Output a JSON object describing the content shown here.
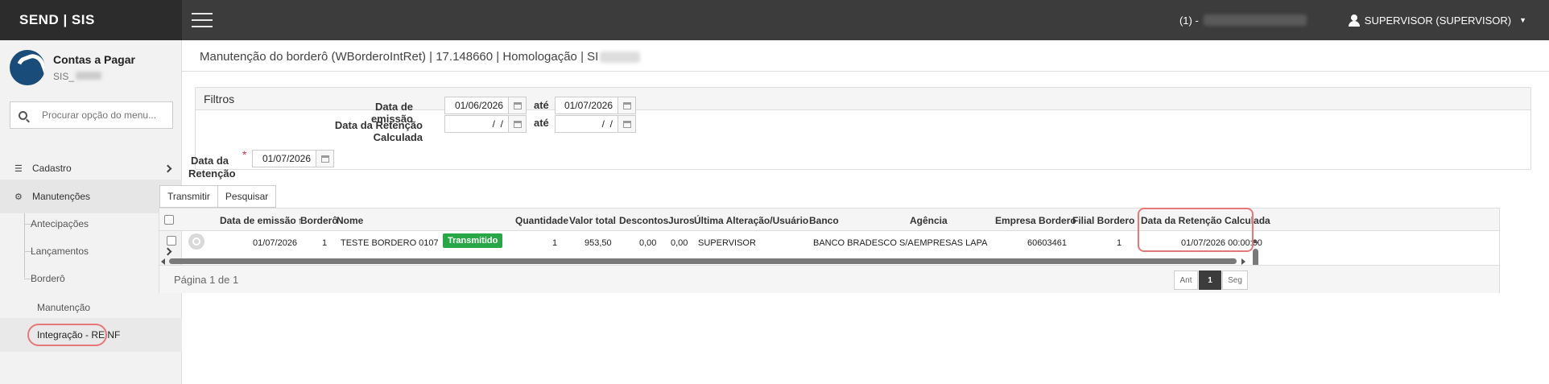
{
  "header": {
    "brand": "SEND | SIS",
    "session_prefix": "(1) -",
    "user": "SUPERVISOR (SUPERVISOR)"
  },
  "sidebar": {
    "title": "Contas a Pagar",
    "subtitle": "SIS_",
    "search_placeholder": "Procurar opção do menu...",
    "items": [
      {
        "label": "Cadastro",
        "icon": "list-icon"
      },
      {
        "label": "Manutenções",
        "icon": "gears-icon"
      }
    ],
    "subitems": [
      {
        "label": "Antecipações"
      },
      {
        "label": "Lançamentos"
      },
      {
        "label": "Borderô"
      }
    ],
    "leaves": [
      {
        "label": "Manutenção"
      },
      {
        "label": "Integração - REINF"
      }
    ]
  },
  "page": {
    "title": "Manutenção do borderô (WBorderoIntRet) | 17.148660 | Homologação | SI"
  },
  "filters": {
    "header": "Filtros",
    "emissao_label": "Data de emissão",
    "emissao_from": "01/06/2026",
    "emissao_to": "01/07/2026",
    "retencao_calc_label": "Data da Retenção Calculada",
    "retencao_calc_from": "  /  /",
    "retencao_calc_to": "  /  /",
    "ate_label": "até"
  },
  "retencao": {
    "label_line1": "Data da",
    "label_line2": "Retenção",
    "required_mark": "*",
    "value": "01/07/2026"
  },
  "toolbar": {
    "transmit_label": "Transmitir",
    "search_label": "Pesquisar"
  },
  "grid": {
    "columns": [
      "Data de emissão",
      "Borderô",
      "Nome",
      "Quantidade",
      "Valor total",
      "Descontos",
      "Juros",
      "Última Alteração/Usuário",
      "Banco",
      "Agência",
      "Empresa Bordero",
      "Filial Bordero",
      "Data da Retenção Calculada"
    ],
    "sort_arrow": "↑",
    "rows": [
      {
        "data_emissao": "01/07/2026",
        "bordero": "1",
        "nome": "TESTE BORDERO 0107",
        "status": "Transmitido",
        "quantidade": "1",
        "valor_total": "953,50",
        "descontos": "0,00",
        "juros": "0,00",
        "usuario": "SUPERVISOR",
        "banco": "BANCO BRADESCO S/A",
        "agencia": "EMPRESAS LAPA",
        "empresa": "60603461",
        "filial": "1",
        "data_retencao_calc": "01/07/2026 00:00:00"
      }
    ]
  },
  "pager": {
    "text": "Página 1 de 1",
    "prev": "Ant",
    "current": "1",
    "next": "Seg"
  },
  "colors": {
    "topbar": "#3c3c3c",
    "brand_bg": "#2c2c2c",
    "status_green": "#27a745",
    "highlight": "#e6787a"
  }
}
